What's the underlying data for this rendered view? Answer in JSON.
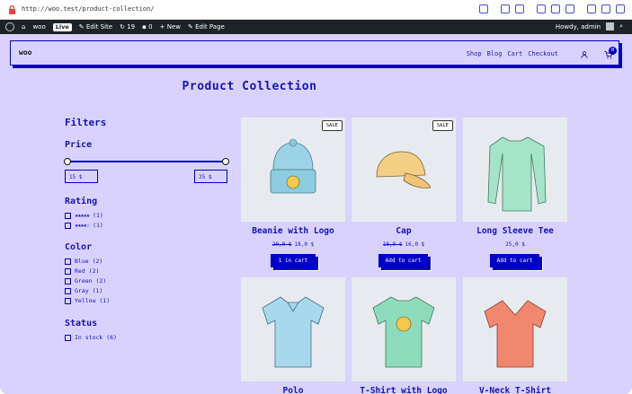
{
  "browser": {
    "url": "http://woo.test/product-collection/"
  },
  "adminbar": {
    "site": "woo",
    "live": "Live",
    "edit_site": "Edit Site",
    "updates": "19",
    "comments": "0",
    "new": "New",
    "edit_page": "Edit Page",
    "howdy": "Howdy, admin"
  },
  "header": {
    "logo": "woo",
    "nav": [
      "Shop",
      "Blog",
      "Cart",
      "Checkout"
    ],
    "cart_count": "0"
  },
  "page_title": "Product Collection",
  "filters": {
    "title": "Filters",
    "price": {
      "heading": "Price",
      "min": "15 $",
      "max": "25 $"
    },
    "rating": {
      "heading": "Rating",
      "options": [
        {
          "stars": "★★★★★",
          "count": "(1)"
        },
        {
          "stars": "★★★★☆",
          "count": "(1)"
        }
      ]
    },
    "color": {
      "heading": "Color",
      "options": [
        "Blue (2)",
        "Red (2)",
        "Green (2)",
        "Gray (1)",
        "Yellow (1)"
      ]
    },
    "status": {
      "heading": "Status",
      "options": [
        "In stock (6)"
      ]
    }
  },
  "products": [
    {
      "name": "Beanie with Logo",
      "sale": "SALE",
      "old_price": "20,0 $",
      "price": "18,0 $",
      "button": "1 in cart"
    },
    {
      "name": "Cap",
      "sale": "SALE",
      "old_price": "18,0 $",
      "price": "16,0 $",
      "button": "Add to cart"
    },
    {
      "name": "Long Sleeve Tee",
      "price": "25,0 $",
      "button": "Add to cart"
    },
    {
      "name": "Polo"
    },
    {
      "name": "T-Shirt with Logo"
    },
    {
      "name": "V-Neck T-Shirt"
    }
  ],
  "colors": {
    "accent": "#0000c8",
    "background": "#d9d2ff",
    "text": "#1414b4"
  }
}
